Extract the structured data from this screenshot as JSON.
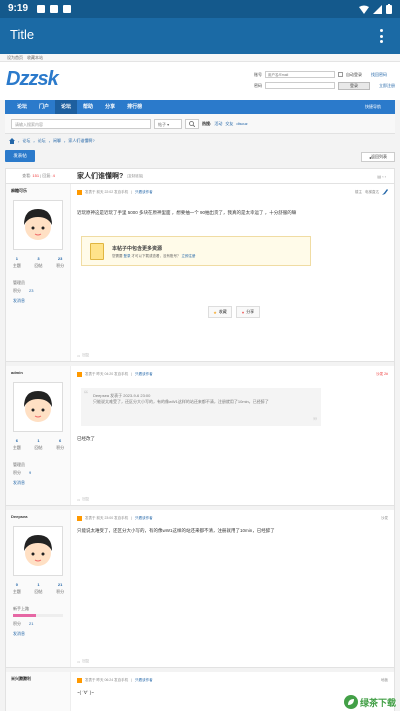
{
  "status_bar": {
    "time": "9:19"
  },
  "app_bar": {
    "title": "Title"
  },
  "topbar": {
    "links": [
      "设为首页",
      "收藏本站"
    ]
  },
  "header": {
    "logo": "Dzzsk",
    "login": {
      "account_label": "账号",
      "account_placeholder": "用户名/Email",
      "auto_login": "自动登录",
      "forgot": "找回密码",
      "password_label": "密码",
      "login_button": "登录",
      "register": "立即注册"
    }
  },
  "nav": {
    "items": [
      "论坛",
      "门户",
      "论坛",
      "帮助",
      "分享",
      "排行榜"
    ],
    "right": "快捷导航"
  },
  "search": {
    "placeholder": "请输入搜索内容",
    "select": "帖子",
    "hot_label": "热搜:",
    "hot": [
      "活动",
      "交友",
      "discuz"
    ]
  },
  "breadcrumb": [
    "论坛",
    "论坛",
    "闲聊",
    "家人们谁懂啊?"
  ],
  "actions": {
    "reply": "发表帖",
    "back": "返回列表"
  },
  "thread": {
    "views_label": "查看:",
    "views": "151",
    "replies_label": "回复:",
    "replies": "4",
    "title": "家人们谁懂啊?",
    "copy_link": "[复制链接]"
  },
  "posts": [
    {
      "user": "麻糖可乐",
      "stats": [
        {
          "v": "1",
          "l": "主题"
        },
        {
          "v": "3",
          "l": "回帖"
        },
        {
          "v": "23",
          "l": "积分"
        }
      ],
      "group": "管理员",
      "points_label": "积分",
      "points": "23",
      "msg": "发消息",
      "meta": "发表于 前天 22:02 发自手机",
      "only": "只看该作者",
      "floor_host": "楼主",
      "floor_extra": "电梯直达",
      "content": "近玩原神这是近玩了手里 5000 多块在原神里面 ，想要抽一个 90抽出货了，我真的是太幸运了 ，十分舒服的嘛"
    },
    {
      "user": "admin",
      "stats": [
        {
          "v": "6",
          "l": "主题"
        },
        {
          "v": "1",
          "l": "回帖"
        },
        {
          "v": "6",
          "l": "积分"
        }
      ],
      "group": "管理员",
      "points_label": "积分",
      "points": "9",
      "msg": "发消息",
      "meta": "发表于 昨天 04:20 发自手机",
      "only": "只看该作者",
      "floor": "沙发 2#",
      "quote_head": "Deepsea 发表于 2023-9-6 23:00",
      "quote": "只能说太难受了，还区分大小写的，有的像wW1这样的站还来都不清，注册就用了10min，已经醉了",
      "content": "已经改了"
    },
    {
      "user": "Deepsea",
      "stats": [
        {
          "v": "0",
          "l": "主题"
        },
        {
          "v": "1",
          "l": "回帖"
        },
        {
          "v": "21",
          "l": "积分"
        }
      ],
      "group": "新手上路",
      "points_label": "积分",
      "points": "21",
      "msg": "发消息",
      "meta": "发表于 前天 23:00 发自手机",
      "only": "只看该作者",
      "floor": "沙发",
      "content": "只能说太难受了，还区分大小写的，有的像wW1这样的站还来都不清，注册就用了10min，已经醉了"
    },
    {
      "user": "米兴腾腾利",
      "meta": "发表于 昨天 06:24 发自手机",
      "only": "只看该作者",
      "floor": "地板",
      "content": "~( ´∀` )~"
    }
  ],
  "resource": {
    "title": "本帖子中包含更多资源",
    "desc_prefix": "您需要",
    "login": "登录",
    "desc_mid": "才可以下载或查看，没有账号？",
    "register": "立即注册"
  },
  "post_buttons": {
    "fav": "收藏",
    "share": "分享"
  },
  "post_footer": "回复",
  "watermark": "绿茶下载"
}
